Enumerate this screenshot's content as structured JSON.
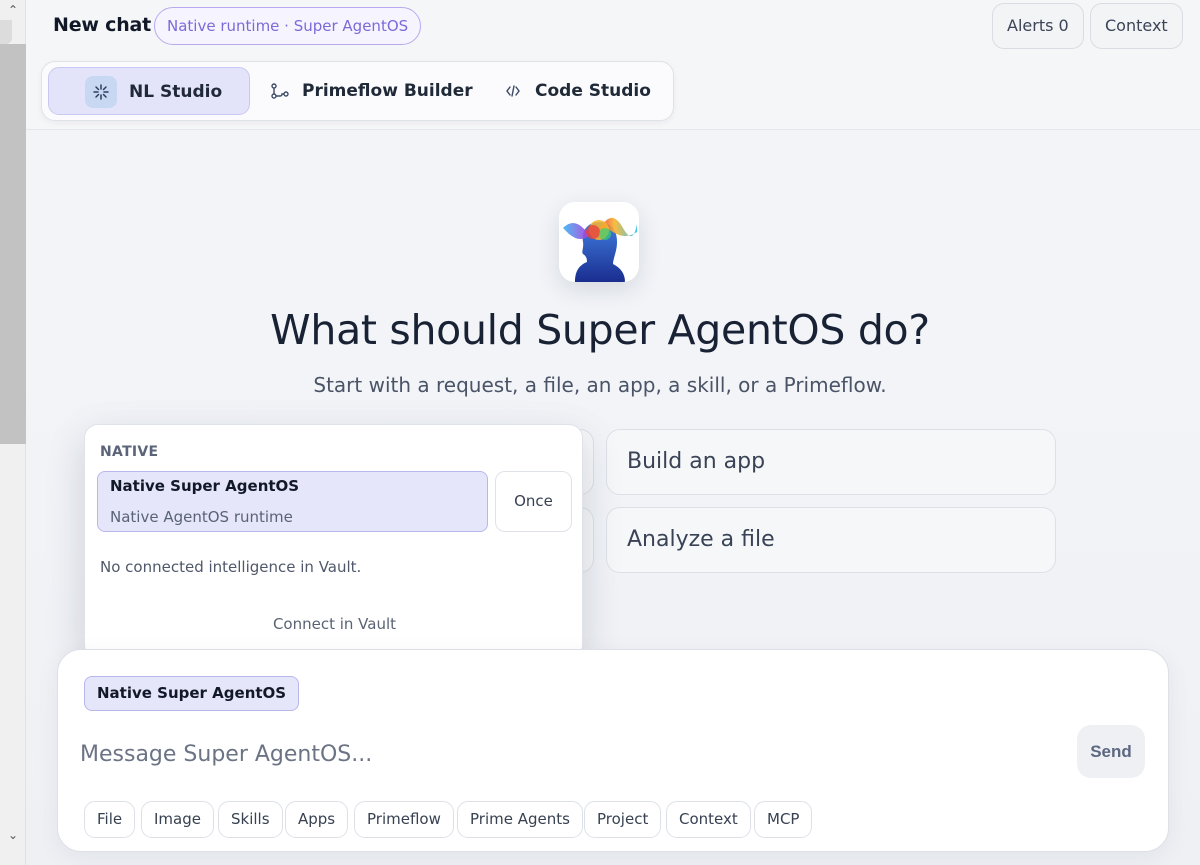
{
  "header": {
    "title": "New chat",
    "runtime_pill": "Native runtime · Super AgentOS",
    "alerts_label": "Alerts 0",
    "context_label": "Context"
  },
  "mode_tabs": [
    {
      "label": "NL Studio",
      "icon": "sparkle-icon",
      "active": true
    },
    {
      "label": "Primeflow Builder",
      "icon": "flow-nodes-icon",
      "active": false
    },
    {
      "label": "Code Studio",
      "icon": "code-brackets-icon",
      "active": false
    }
  ],
  "hero": {
    "title": "What should Super AgentOS do?",
    "subtitle": "Start with a request, a file, an app, a skill, or a Primeflow."
  },
  "suggestions": {
    "build": "Build an app",
    "analyze": "Analyze a file"
  },
  "popup": {
    "section": "NATIVE",
    "option_name": "Native Super AgentOS",
    "option_desc": "Native AgentOS runtime",
    "once_label": "Once",
    "empty_text": "No connected intelligence in Vault.",
    "connect_label": "Connect in Vault"
  },
  "composer": {
    "agent_chip": "Native Super AgentOS",
    "placeholder": "Message Super AgentOS...",
    "send_label": "Send",
    "chips": [
      "File",
      "Image",
      "Skills",
      "Apps",
      "Primeflow",
      "Prime Agents",
      "Project",
      "Context",
      "MCP"
    ]
  },
  "colors": {
    "accent": "#7c6ad7",
    "active_tab_bg": "#e3e4fa",
    "selected_bg": "#e6e6fb"
  }
}
